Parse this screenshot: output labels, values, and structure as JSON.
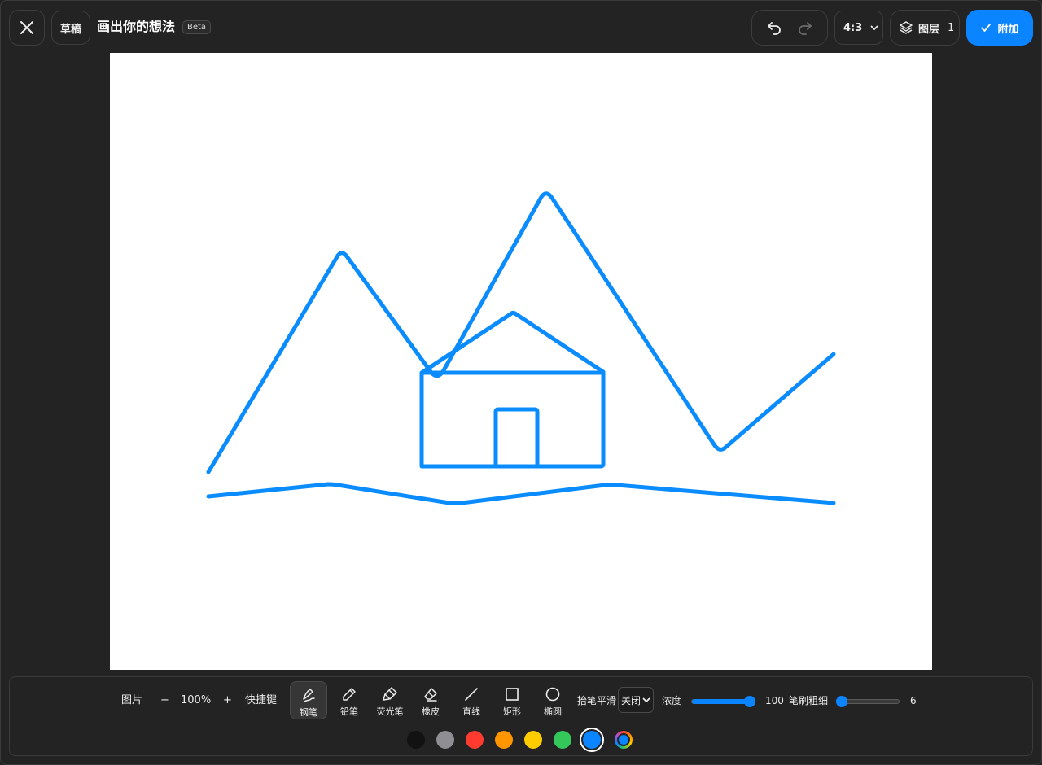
{
  "header": {
    "draft_label": "草稿",
    "title": "画出你的想法",
    "beta_badge": "Beta",
    "aspect_ratio": "4:3",
    "layers_label": "图层",
    "layers_count": "1",
    "attach_label": "附加"
  },
  "toolbar": {
    "image_label": "图片",
    "zoom_minus": "−",
    "zoom_level": "100%",
    "zoom_plus": "+",
    "shortcuts_label": "快捷键",
    "tools": [
      {
        "label": "钢笔",
        "icon": "pen-icon",
        "active": true
      },
      {
        "label": "铅笔",
        "icon": "pencil-icon",
        "active": false
      },
      {
        "label": "荧光笔",
        "icon": "highlighter-icon",
        "active": false
      },
      {
        "label": "橡皮",
        "icon": "eraser-icon",
        "active": false
      },
      {
        "label": "直线",
        "icon": "line-icon",
        "active": false
      },
      {
        "label": "矩形",
        "icon": "rectangle-icon",
        "active": false
      },
      {
        "label": "椭圆",
        "icon": "ellipse-icon",
        "active": false
      }
    ],
    "smoothing_label": "抬笔平滑",
    "smoothing_value": "关闭",
    "opacity_label": "浓度",
    "opacity_value": "100",
    "opacity_fraction": 1.0,
    "brush_size_label": "笔刷粗细",
    "brush_size_value": "6",
    "brush_size_fraction": 0.06
  },
  "palette": {
    "colors": [
      "#121212",
      "#8e8e93",
      "#ff3b30",
      "#ff9500",
      "#ffcc00",
      "#34c759",
      "#0a84ff"
    ],
    "selected_color": "#0a84ff",
    "stroke_color": "#0a84ff"
  }
}
